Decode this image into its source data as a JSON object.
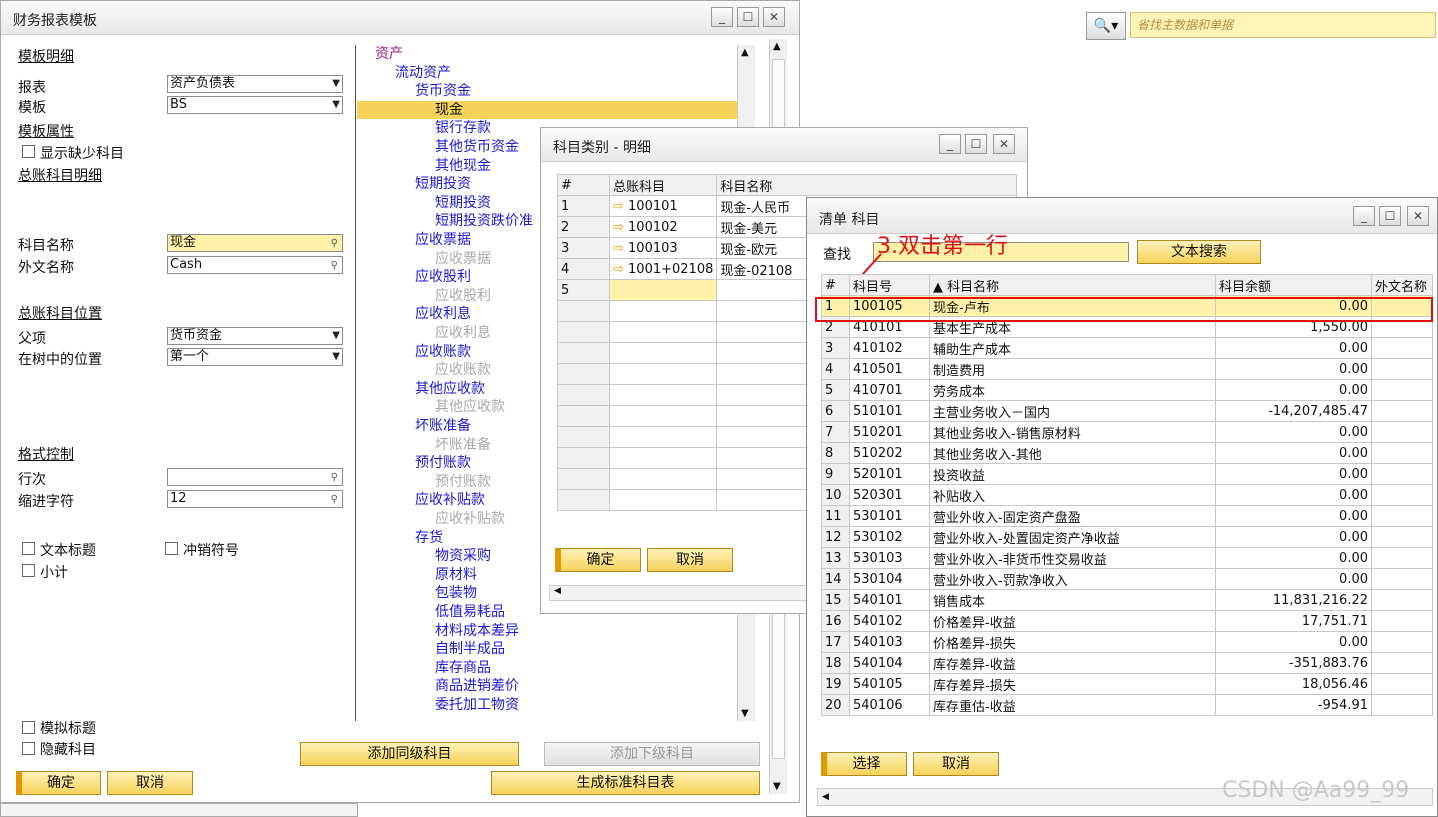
{
  "bg_search": {
    "placeholder": "省找主数据和单据"
  },
  "main": {
    "title": "财务报表模板",
    "sec_detail": "模板明细",
    "report_label": "报表",
    "report_value": "资产负债表",
    "template_label": "模板",
    "template_value": "BS",
    "attr_header": "模板属性",
    "show_missing": "显示缺少科目",
    "gl_detail": "总账科目明细",
    "acct_name_label": "科目名称",
    "acct_name_value": "现金",
    "foreign_name_label": "外文名称",
    "foreign_name_value": "Cash",
    "gl_pos_header": "总账科目位置",
    "parent_label": "父项",
    "parent_value": "货币资金",
    "tree_pos_label": "在树中的位置",
    "tree_pos_value": "第一个",
    "format_header": "格式控制",
    "row_label": "行次",
    "row_value": "",
    "indent_label": "缩进字符",
    "indent_value": "12",
    "text_title": "文本标题",
    "reversal": "冲销符号",
    "subtotal": "小计",
    "dummy_title": "模拟标题",
    "hide_account": "隐藏科目",
    "ok": "确定",
    "cancel": "取消",
    "add_same": "添加同级科目",
    "add_child": "添加下级科目",
    "generate": "生成标准科目表",
    "tree": [
      "资产",
      "流动资产",
      "货币资金",
      "现金",
      "银行存款",
      "其他货币资金",
      "其他现金",
      "短期投资",
      "短期投资",
      "短期投资跌价准",
      "应收票据",
      "应收票据",
      "应收股利",
      "应收股利",
      "应收利息",
      "应收利息",
      "应收账款",
      "应收账款",
      "其他应收款",
      "其他应收款",
      "坏账准备",
      "坏账准备",
      "预付账款",
      "预付账款",
      "应收补贴款",
      "应收补贴款",
      "存货",
      "物资采购",
      "原材料",
      "包装物",
      "低值易耗品",
      "材料成本差异",
      "自制半成品",
      "库存商品",
      "商品进销差价",
      "委托加工物资"
    ]
  },
  "cat": {
    "title": "科目类别 - 明细",
    "col_num": "#",
    "col_gl": "总账科目",
    "col_name": "科目名称",
    "rows": [
      [
        "1",
        "100101",
        "现金-人民币"
      ],
      [
        "2",
        "100102",
        "现金-美元"
      ],
      [
        "3",
        "100103",
        "现金-欧元"
      ],
      [
        "4",
        "1001+02108",
        "现金-02108"
      ],
      [
        "5",
        "",
        ""
      ]
    ],
    "ok": "确定",
    "cancel": "取消"
  },
  "list": {
    "title": "清单 科目",
    "find_label": "查找",
    "text_search": "文本搜索",
    "annotation": "3.双击第一行",
    "col_num": "#",
    "col_no": "科目号",
    "col_name": "科目名称",
    "col_bal": "科目余额",
    "col_foreign": "外文名称",
    "rows": [
      [
        "1",
        "100105",
        "现金-卢布",
        "0.00"
      ],
      [
        "2",
        "410101",
        "基本生产成本",
        "1,550.00"
      ],
      [
        "3",
        "410102",
        "辅助生产成本",
        "0.00"
      ],
      [
        "4",
        "410501",
        "制造费用",
        "0.00"
      ],
      [
        "5",
        "410701",
        "劳务成本",
        "0.00"
      ],
      [
        "6",
        "510101",
        "主营业务收入－国内",
        "-14,207,485.47"
      ],
      [
        "7",
        "510201",
        "其他业务收入-销售原材料",
        "0.00"
      ],
      [
        "8",
        "510202",
        "其他业务收入-其他",
        "0.00"
      ],
      [
        "9",
        "520101",
        "投资收益",
        "0.00"
      ],
      [
        "10",
        "520301",
        "补贴收入",
        "0.00"
      ],
      [
        "11",
        "530101",
        "营业外收入-固定资产盘盈",
        "0.00"
      ],
      [
        "12",
        "530102",
        "营业外收入-处置固定资产净收益",
        "0.00"
      ],
      [
        "13",
        "530103",
        "营业外收入-非货币性交易收益",
        "0.00"
      ],
      [
        "14",
        "530104",
        "营业外收入-罚款净收入",
        "0.00"
      ],
      [
        "15",
        "540101",
        "销售成本",
        "11,831,216.22"
      ],
      [
        "16",
        "540102",
        "价格差异-收益",
        "17,751.71"
      ],
      [
        "17",
        "540103",
        "价格差异-损失",
        "0.00"
      ],
      [
        "18",
        "540104",
        "库存差异-收益",
        "-351,883.76"
      ],
      [
        "19",
        "540105",
        "库存差异-损失",
        "18,056.46"
      ],
      [
        "20",
        "540106",
        "库存重估-收益",
        "-954.91"
      ]
    ],
    "choose": "选择",
    "cancel": "取消"
  },
  "watermark": "CSDN @Aa99_99",
  "colors": {
    "accent": "#f6d25a",
    "highlight_border": "#e01010",
    "annotation": "#e01010"
  }
}
